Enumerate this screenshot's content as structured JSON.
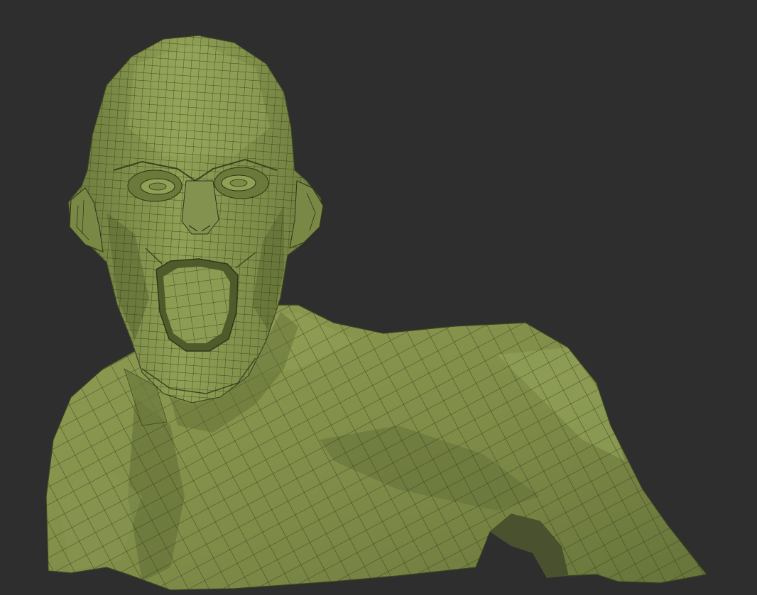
{
  "viewport": {
    "background": "#2e2e2f"
  },
  "model": {
    "name": "sculpt-bust",
    "shading": "polyframe",
    "base_color": "#7f8c48",
    "light_color": "#97a45a",
    "shadow_color": "#5d6a33",
    "wire_color": "#2d3418"
  }
}
